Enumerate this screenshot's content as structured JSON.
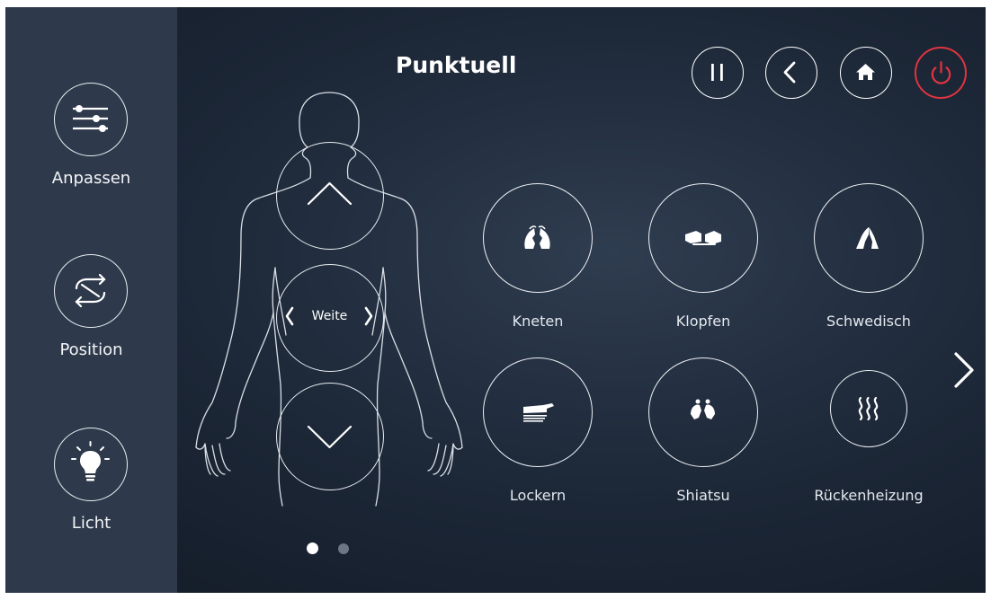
{
  "title": "Punktuell",
  "sidebar": {
    "items": [
      {
        "label": "Anpassen",
        "icon": "sliders-icon"
      },
      {
        "label": "Position",
        "icon": "rotate-arrows-icon"
      },
      {
        "label": "Licht",
        "icon": "lightbulb-icon"
      }
    ]
  },
  "top_buttons": [
    {
      "icon": "pause-icon"
    },
    {
      "icon": "back-chevron-icon"
    },
    {
      "icon": "home-icon"
    },
    {
      "icon": "power-icon",
      "color": "#e0343f"
    }
  ],
  "position_control": {
    "up_icon": "chevron-up-icon",
    "width_label": "Weite",
    "down_icon": "chevron-down-icon"
  },
  "modes": [
    {
      "label": "Kneten",
      "icon": "kneading-hands-icon"
    },
    {
      "label": "Klopfen",
      "icon": "tapping-fists-icon"
    },
    {
      "label": "Schwedisch",
      "icon": "swedish-hands-icon"
    },
    {
      "label": "Lockern",
      "icon": "loosening-hand-icon"
    },
    {
      "label": "Shiatsu",
      "icon": "shiatsu-thumbs-icon"
    },
    {
      "label": "Rückenheizung",
      "icon": "heat-waves-icon"
    }
  ],
  "pagination": {
    "pages": 2,
    "current": 1
  },
  "colors": {
    "sidebar": "#2e3a4b",
    "background": "#1d2838",
    "accent_power": "#e0343f"
  }
}
